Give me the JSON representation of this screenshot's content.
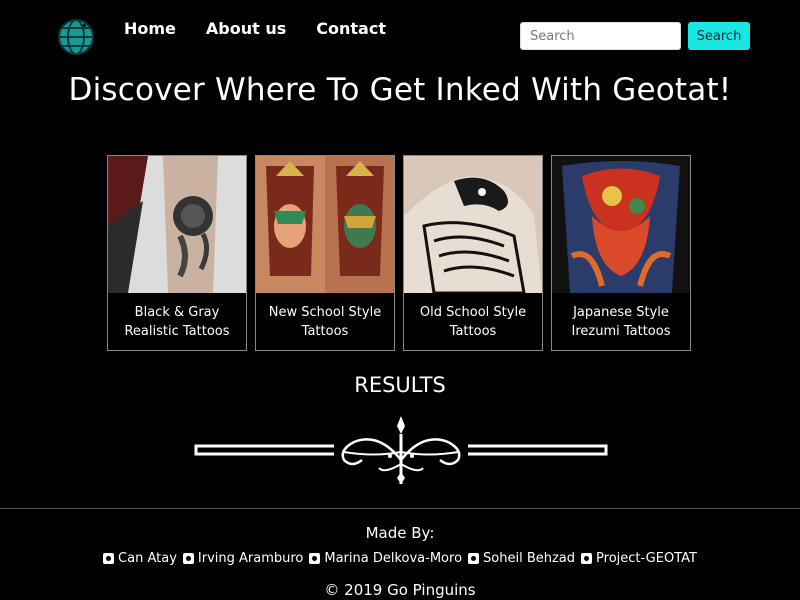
{
  "nav": {
    "logo_icon": "globe-icon",
    "links": [
      "Home",
      "About us",
      "Contact"
    ],
    "search_placeholder": "Search",
    "search_button": "Search",
    "accent_color": "#19e6e0"
  },
  "headline": "Discover Where To Get Inked With Geotat!",
  "cards": [
    {
      "title": "Black & Gray Realistic Tattoos",
      "image": "black-gray-rose-tattoo"
    },
    {
      "title": "New School Style Tattoos",
      "image": "new-school-face-tattoo"
    },
    {
      "title": "Old School Style Tattoos",
      "image": "old-school-eagle-tattoo"
    },
    {
      "title": "Japanese Style Irezumi Tattoos",
      "image": "japanese-irezumi-back-tattoo"
    }
  ],
  "results_heading": "RESULTS",
  "footer": {
    "made_by": "Made By:",
    "credits": [
      {
        "name": "Can Atay",
        "icon": "github-icon"
      },
      {
        "name": "Irving Aramburo",
        "icon": "github-icon"
      },
      {
        "name": "Marina Delkova-Moro",
        "icon": "github-icon"
      },
      {
        "name": "Soheil Behzad",
        "icon": "github-icon"
      },
      {
        "name": "Project-GEOTAT",
        "icon": "github-icon"
      }
    ],
    "copyright": "© 2019 Go Pinguins"
  }
}
